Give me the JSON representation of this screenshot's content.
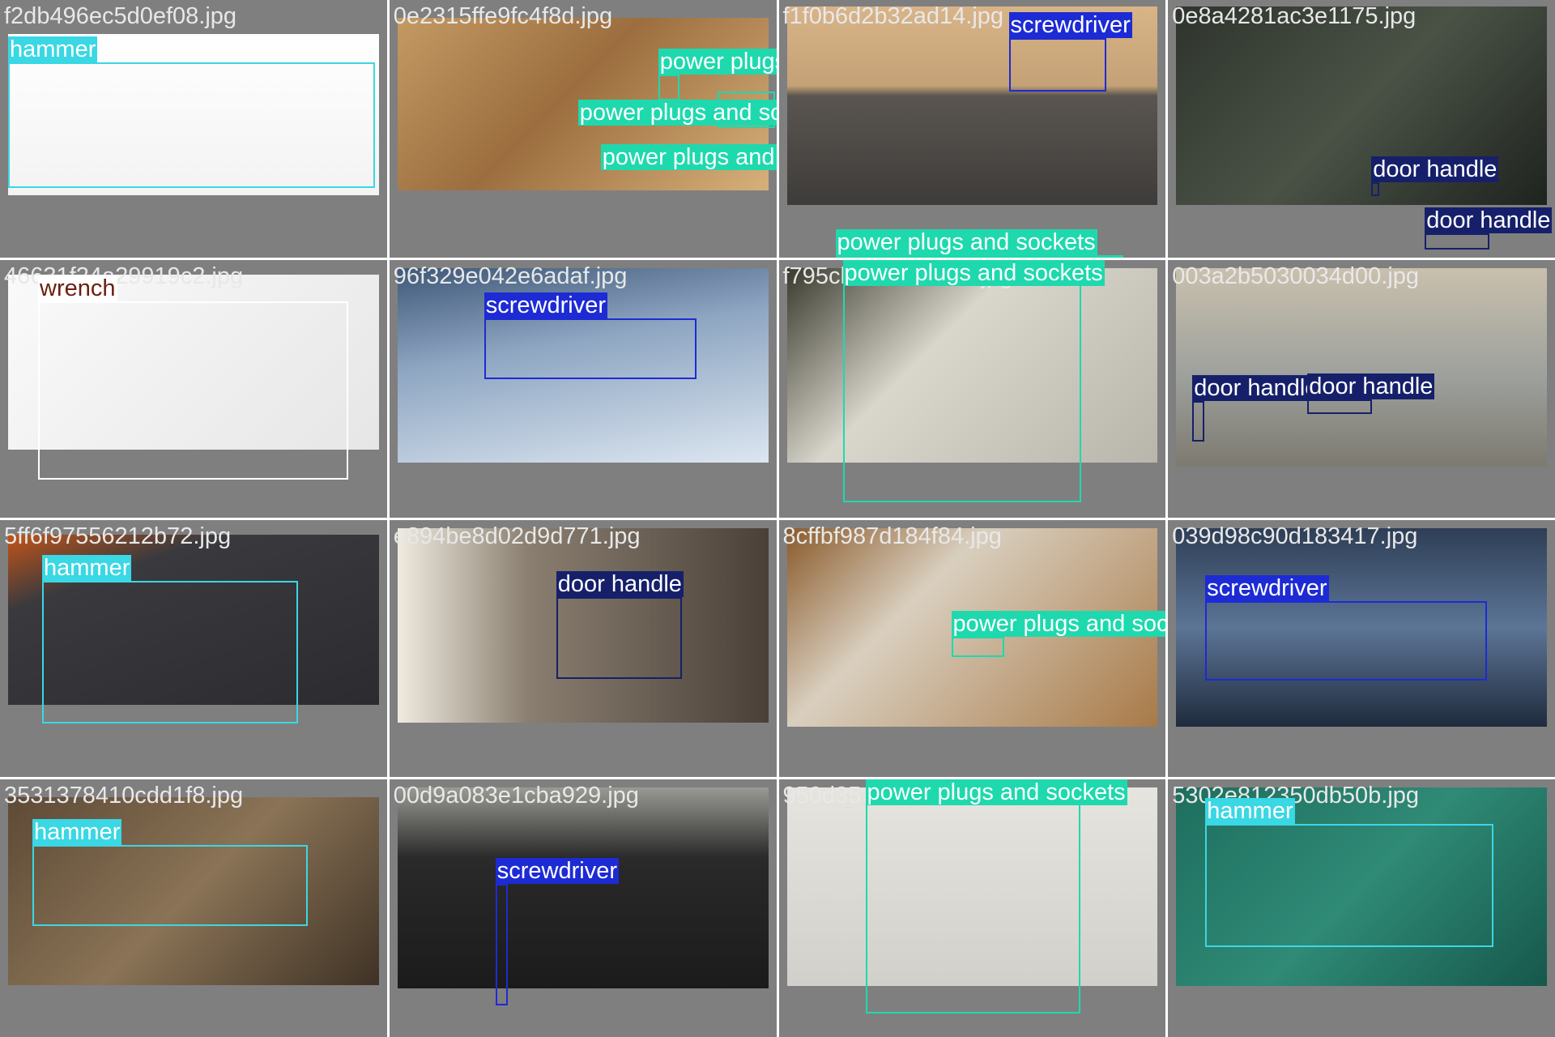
{
  "colors": {
    "tile_background": "#7f7f7f",
    "filename_text": "#e8e8e8",
    "hammer": "#3ad7e4",
    "wrench": "#ffffff",
    "screwdriver": "#1d2bd4",
    "door handle": "#16206a",
    "power plugs and sockets": "#1ed9ad"
  },
  "tiles": [
    {
      "filename": "f2db496ec5d0ef08.jpg",
      "labels": [
        "hammer"
      ]
    },
    {
      "filename": "0e2315ffe9fc4f8d.jpg",
      "labels": [
        "power plugs and sockets",
        "power plugs and sockets",
        "power plugs and sockets"
      ]
    },
    {
      "filename": "f1f0b6d2b32ad14.jpg",
      "labels": [
        "screwdriver",
        "power plugs and sockets"
      ]
    },
    {
      "filename": "0e8a4281ac3e1175.jpg",
      "labels": [
        "door handle",
        "door handle"
      ]
    },
    {
      "filename": "46631f24a29919c2.jpg",
      "labels": [
        "wrench"
      ]
    },
    {
      "filename": "96f329e042e6adaf.jpg",
      "labels": [
        "screwdriver"
      ]
    },
    {
      "filename": "f795cb3c601c143f.jpg",
      "labels": [
        "power plugs and sockets"
      ]
    },
    {
      "filename": "003a2b5030034d00.jpg",
      "labels": [
        "door handle",
        "door handle"
      ]
    },
    {
      "filename": "5ff6f97556212b72.jpg",
      "labels": [
        "hammer"
      ]
    },
    {
      "filename": "e894be8d02d9d771.jpg",
      "labels": [
        "door handle"
      ]
    },
    {
      "filename": "8cffbf987d184f84.jpg",
      "labels": [
        "power plugs and sockets"
      ]
    },
    {
      "filename": "039d98c90d183417.jpg",
      "labels": [
        "screwdriver"
      ]
    },
    {
      "filename": "3531378410cdd1f8.jpg",
      "labels": [
        "hammer"
      ]
    },
    {
      "filename": "00d9a083e1cba929.jpg",
      "labels": [
        "screwdriver"
      ]
    },
    {
      "filename": "950d35",
      "labels": [
        "power plugs and sockets"
      ]
    },
    {
      "filename": "5302e812350db50b.jpg",
      "labels": [
        "hammer"
      ]
    }
  ]
}
